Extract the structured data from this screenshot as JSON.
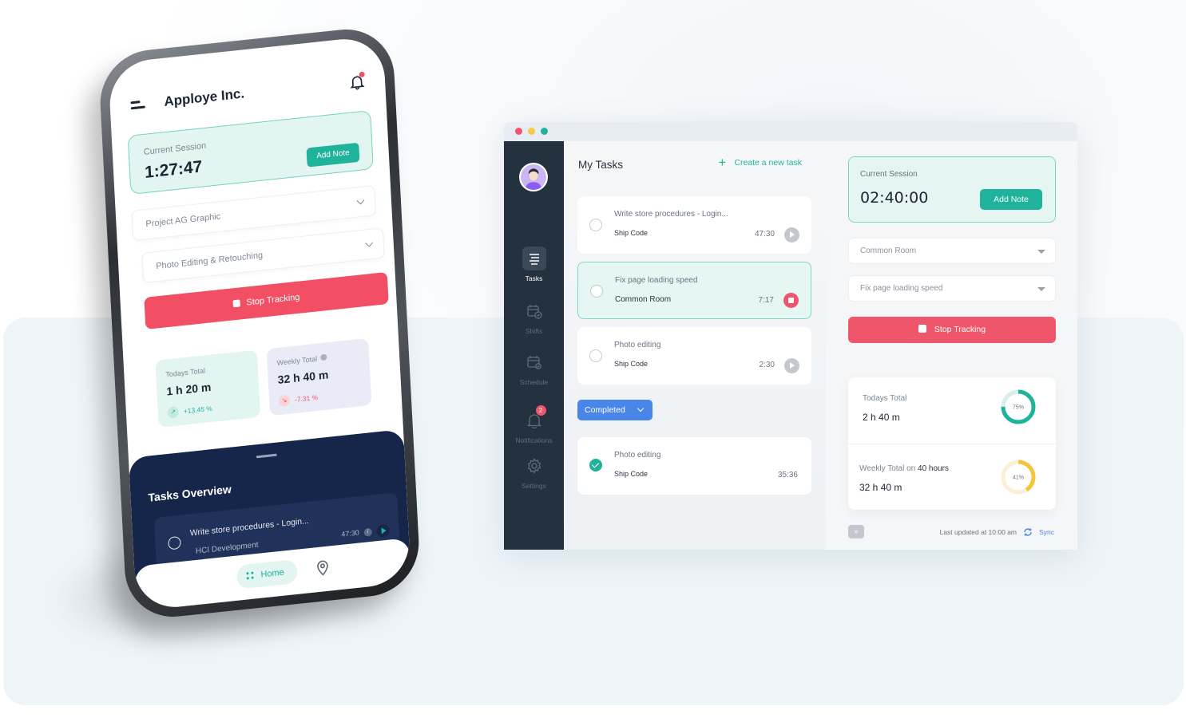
{
  "mobile": {
    "app_title": "Apploye Inc.",
    "menu_icon": "hamburger-menu-icon",
    "bell_icon": "bell-icon",
    "session": {
      "label": "Current Session",
      "time": "1:27:47",
      "add_note_label": "Add Note"
    },
    "project_select": {
      "value": "Project AG Graphic"
    },
    "task_select": {
      "value": "Photo Editing & Retouching"
    },
    "stop_tracking_label": "Stop Tracking",
    "today_total": {
      "label": "Todays Total",
      "value": "1 h 20 m",
      "change": "+13.45 %",
      "trend": "up"
    },
    "weekly_total": {
      "label": "Weekly Total",
      "value": "32 h 40 m",
      "change": "-7.31 %",
      "trend": "down"
    },
    "tasks_overview": {
      "title": "Tasks Overview",
      "task": {
        "name": "Write store procedures - Login...",
        "project": "HCI Development",
        "time": "47:30"
      }
    },
    "nav": {
      "home_label": "Home"
    }
  },
  "desktop": {
    "window_controls": [
      "close",
      "minimize",
      "maximize"
    ],
    "sidebar": {
      "items": [
        {
          "label": "Tasks",
          "icon": "tasks-list-icon",
          "active": true
        },
        {
          "label": "Shifts",
          "icon": "shifts-calendar-icon",
          "active": false
        },
        {
          "label": "Schedule",
          "icon": "schedule-calendar-icon",
          "active": false
        },
        {
          "label": "Notifications",
          "icon": "bell-icon",
          "active": false,
          "badge": "2"
        },
        {
          "label": "Settings",
          "icon": "gear-icon",
          "active": false
        }
      ]
    },
    "main": {
      "title": "My Tasks",
      "create_task_label": "Create a new task",
      "tasks": [
        {
          "name": "Write store procedures - Login...",
          "project": "Ship Code",
          "time": "47:30",
          "state": "paused"
        },
        {
          "name": "Fix page loading speed",
          "project": "Common Room",
          "time": "7:17",
          "state": "running"
        },
        {
          "name": "Photo editing",
          "project": "Ship Code",
          "time": "2:30",
          "state": "paused"
        }
      ],
      "completed_filter_label": "Completed",
      "completed_tasks": [
        {
          "name": "Photo editing",
          "project": "Ship Code",
          "time": "35:36",
          "state": "done"
        }
      ]
    },
    "right_panel": {
      "session": {
        "label": "Current Session",
        "time": "02:40:00",
        "add_note_label": "Add Note"
      },
      "project_select": {
        "value": "Common Room"
      },
      "task_select": {
        "value": "Fix page loading speed"
      },
      "stop_tracking_label": "Stop Tracking",
      "today_total": {
        "label": "Todays Total",
        "value": "2 h 40 m",
        "percent": 75,
        "percent_label": "75%",
        "color": "#1fb39b"
      },
      "weekly_total": {
        "label_prefix": "Weekly Total on",
        "label_goal": "40 hours",
        "value": "32 h 40 m",
        "percent": 41,
        "percent_label": "41%",
        "color": "#f5c43a"
      },
      "last_updated": "Last updated at 10:00 am",
      "sync_label": "Sync"
    }
  },
  "colors": {
    "accent_teal": "#1fb39b",
    "danger_red": "#f0566b",
    "primary_blue": "#4a86ea",
    "sidebar_dark": "#243240",
    "sheet_navy": "#16264b"
  }
}
